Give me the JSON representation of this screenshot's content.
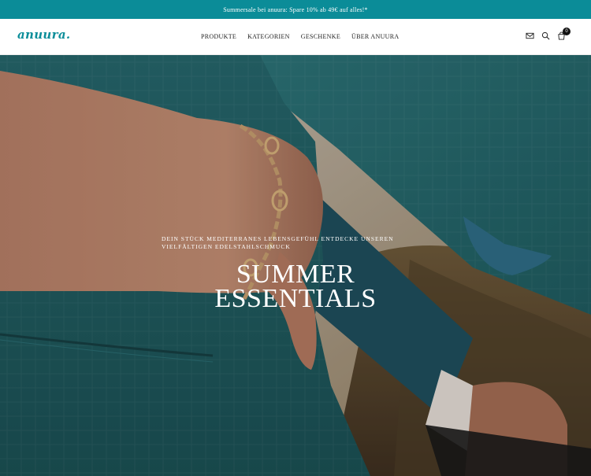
{
  "announcement": {
    "text": "Summersale bei anuura: Spare 10% ab 49€ auf alles!*"
  },
  "header": {
    "logo": "anuura.",
    "nav": [
      {
        "label": "PRODUKTE"
      },
      {
        "label": "KATEGORIEN"
      },
      {
        "label": "GESCHENKE"
      },
      {
        "label": "ÜBER ANUURA"
      }
    ],
    "icons": [
      "mail-icon",
      "search-icon",
      "cart-icon"
    ],
    "cart_count": "0"
  },
  "hero": {
    "subtitle": "DEIN STÜCK MEDITERRANES LEBENSGEFÜHL ENTDECKE UNSEREN VIELFÄLTIGEN EDELSTAHLSCHMUCK",
    "title_line1": "SUMMER",
    "title_line2": "ESSENTIALS"
  },
  "colors": {
    "accent": "#0b8c98",
    "logo": "#0d8e9a",
    "text": "#1c1c1c"
  }
}
